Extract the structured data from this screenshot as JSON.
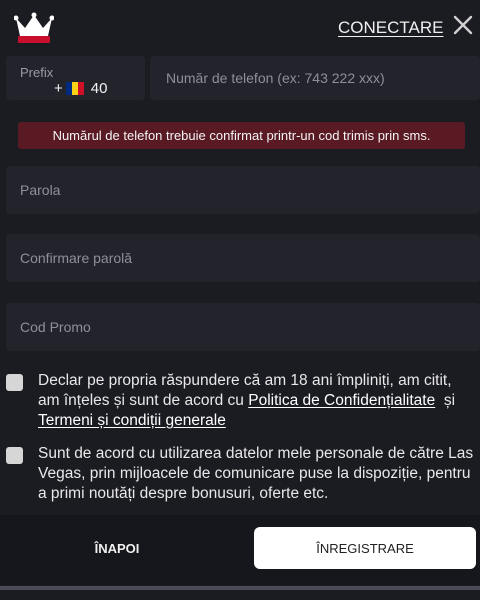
{
  "header": {
    "login_label": "CONECTARE",
    "logo_icon": "crown-logo-icon",
    "close_icon": "close-icon"
  },
  "phone": {
    "prefix_label": "Prefix",
    "prefix_value": "+ 40",
    "prefix_plus": "+",
    "prefix_code": "40",
    "placeholder": "Număr de telefon (ex: 743 222 xxx)",
    "flag_colors": [
      "#002b7f",
      "#fcd116",
      "#ce1126"
    ]
  },
  "alert": {
    "message": "Numărul de telefon trebuie confirmat printr-un cod trimis prin sms.",
    "color": "#5a1a24"
  },
  "fields": {
    "password_placeholder": "Parola",
    "confirm_placeholder": "Confirmare parolă",
    "promo_placeholder": "Cod Promo"
  },
  "consent": {
    "age_text_start": "Declar pe propria răspundere că am 18 ani împliniți, am citit, am înțeles și sunt de acord cu",
    "privacy_link": "Politica de Confidențialitate",
    "and_word": "și",
    "terms_link": "Termeni și condiții generale",
    "marketing_text": "Sunt de acord cu utilizarea datelor mele personale de către Las Vegas, prin mijloacele de comunicare puse la dispoziție, pentru a primi noutăți despre bonusuri, oferte etc."
  },
  "buttons": {
    "back_label": "ÎNAPOI",
    "register_label": "ÎNREGISTRARE"
  }
}
